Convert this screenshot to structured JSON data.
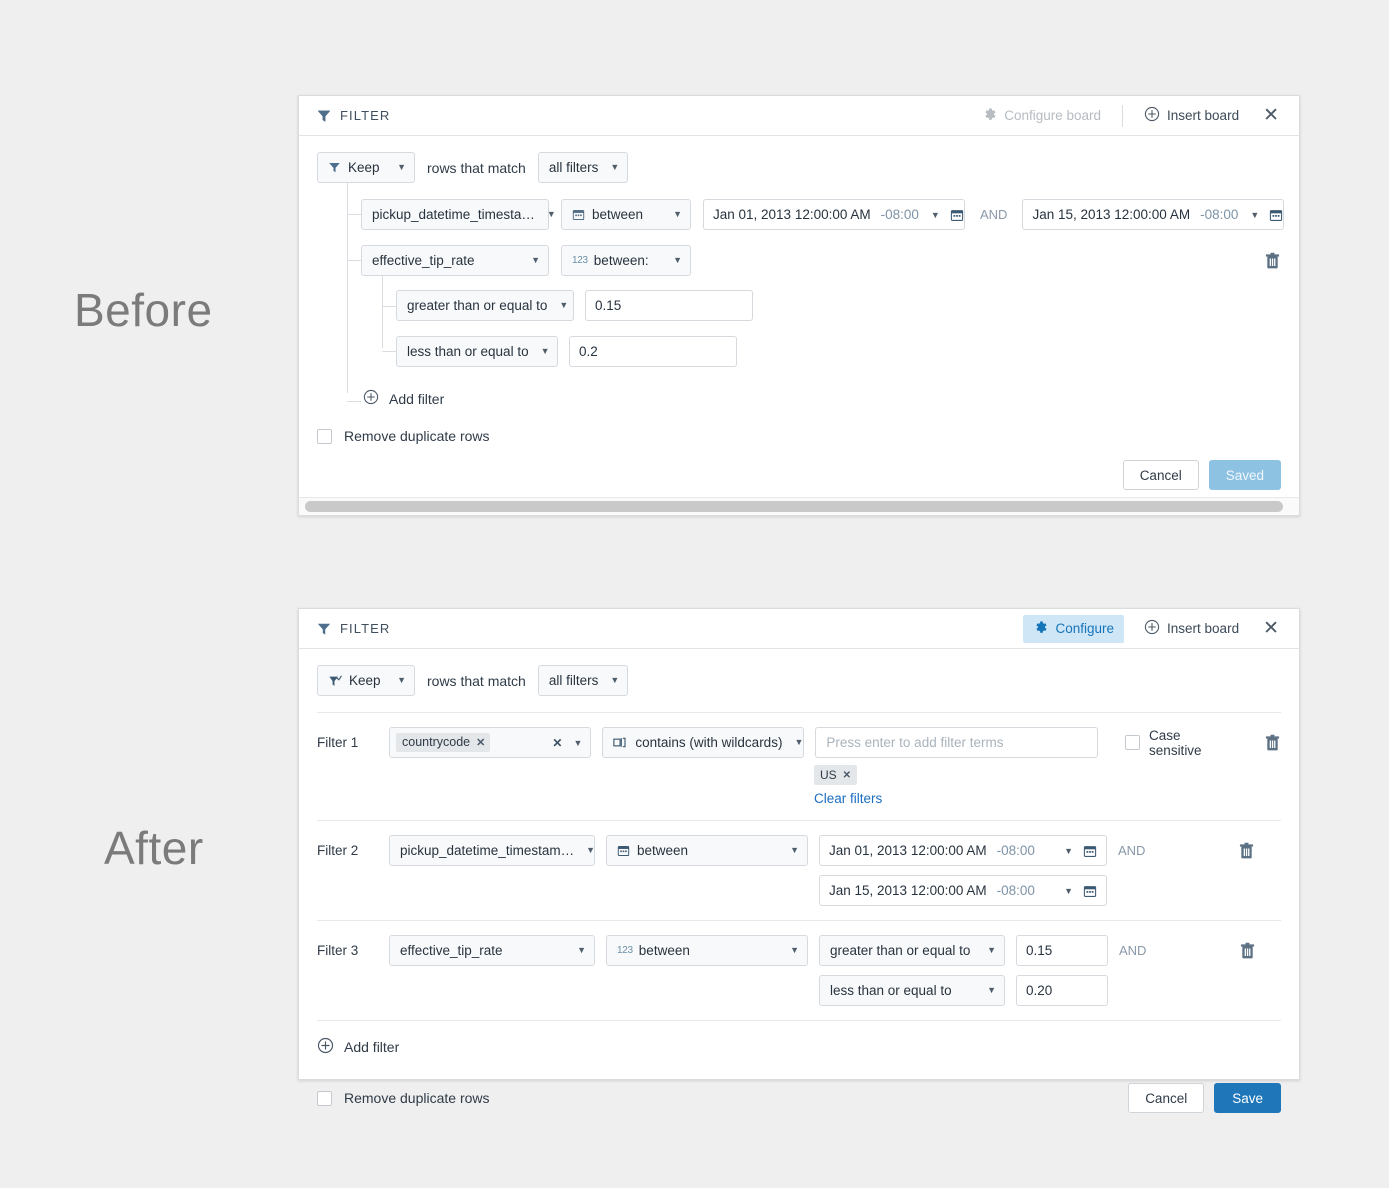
{
  "labels": {
    "before": "Before",
    "after": "After"
  },
  "before_panel": {
    "header": {
      "title": "FILTER",
      "configure_board": "Configure board",
      "insert_board": "Insert board",
      "close": "✕"
    },
    "keep_row": {
      "keep": "Keep",
      "middle_text": "rows that match",
      "match_mode": "all filters"
    },
    "rows": [
      {
        "field": "pickup_datetime_timesta…",
        "operator": "between",
        "operator_type": "date",
        "date_from": "Jan 01, 2013 12:00:00 AM",
        "tz_from": "-08:00",
        "conjunction": "AND",
        "date_to": "Jan 15, 2013 12:00:00 AM",
        "tz_to": "-08:00"
      },
      {
        "field": "effective_tip_rate",
        "operator": "between:",
        "operator_type": "number",
        "number_badge": "123",
        "sub_rows": [
          {
            "operator": "greater than or equal to",
            "value": "0.15"
          },
          {
            "operator": "less than or equal to",
            "value": "0.2"
          }
        ]
      }
    ],
    "add_filter": "Add filter",
    "remove_duplicate_rows": "Remove duplicate rows",
    "cancel": "Cancel",
    "save": "Saved"
  },
  "after_panel": {
    "header": {
      "title": "FILTER",
      "configure": "Configure",
      "insert_board": "Insert board",
      "close": "✕"
    },
    "keep_row": {
      "keep": "Keep",
      "middle_text": "rows that match",
      "match_mode": "all filters"
    },
    "filters": [
      {
        "label": "Filter 1",
        "field_chip": "countrycode",
        "operator": "contains (with wildcards)",
        "operator_type": "string",
        "terms_placeholder": "Press enter to add filter terms",
        "terms": [
          "US"
        ],
        "clear_filters": "Clear filters",
        "case_sensitive_label": "Case sensitive",
        "case_sensitive_checked": false
      },
      {
        "label": "Filter 2",
        "field": "pickup_datetime_timestam…",
        "operator": "between",
        "operator_type": "date",
        "date_from": "Jan 01, 2013 12:00:00 AM",
        "tz_from": "-08:00",
        "conjunction": "AND",
        "date_to": "Jan 15, 2013 12:00:00 AM",
        "tz_to": "-08:00"
      },
      {
        "label": "Filter 3",
        "field": "effective_tip_rate",
        "operator": "between",
        "operator_type": "number",
        "number_badge": "123",
        "cmp_from": "greater than or equal to",
        "value_from": "0.15",
        "conjunction": "AND",
        "cmp_to": "less than or equal to",
        "value_to": "0.20"
      }
    ],
    "add_filter": "Add filter",
    "remove_duplicate_rows": "Remove duplicate rows",
    "cancel": "Cancel",
    "save": "Save"
  },
  "colors": {
    "page_bg": "#efefef",
    "accent_blue": "#1f76b9",
    "link_blue": "#1b6ec2",
    "active_chip_bg": "#cfe6f7",
    "saved_disabled": "#8ec2e3",
    "icon_slate": "#5c7184"
  }
}
